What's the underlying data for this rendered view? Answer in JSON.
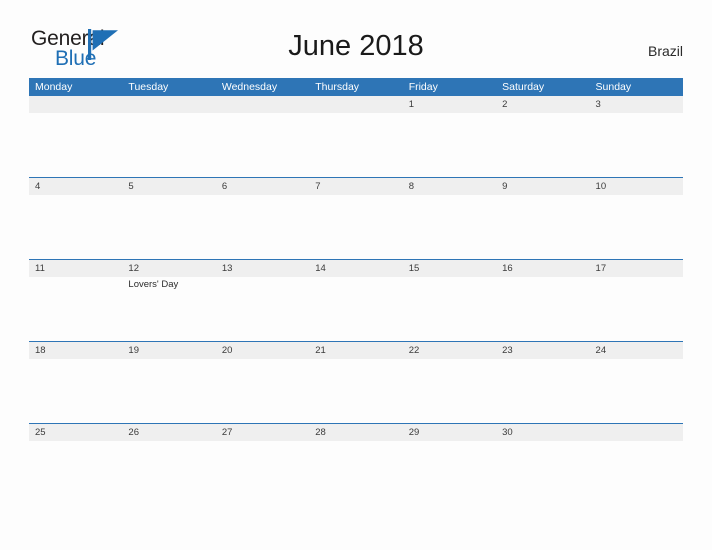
{
  "brand": {
    "name_part1": "General",
    "name_part2": "Blue",
    "mark": "triangle-flag-icon",
    "color_dark": "#221f1f",
    "color_blue": "#1f6fb5"
  },
  "header": {
    "title": "June 2018",
    "country": "Brazil"
  },
  "theme": {
    "header_blue": "#2e75b6",
    "date_band_gray": "#efefef",
    "row_divider": "#2e75b6",
    "page_background": "#fdfdfd"
  },
  "calendar": {
    "month": "June",
    "year": "2018",
    "week_start": "Monday",
    "weekdays": [
      "Monday",
      "Tuesday",
      "Wednesday",
      "Thursday",
      "Friday",
      "Saturday",
      "Sunday"
    ],
    "weeks": [
      {
        "days": [
          {
            "date": "",
            "event": ""
          },
          {
            "date": "",
            "event": ""
          },
          {
            "date": "",
            "event": ""
          },
          {
            "date": "",
            "event": ""
          },
          {
            "date": "1",
            "event": ""
          },
          {
            "date": "2",
            "event": ""
          },
          {
            "date": "3",
            "event": ""
          }
        ]
      },
      {
        "days": [
          {
            "date": "4",
            "event": ""
          },
          {
            "date": "5",
            "event": ""
          },
          {
            "date": "6",
            "event": ""
          },
          {
            "date": "7",
            "event": ""
          },
          {
            "date": "8",
            "event": ""
          },
          {
            "date": "9",
            "event": ""
          },
          {
            "date": "10",
            "event": ""
          }
        ]
      },
      {
        "days": [
          {
            "date": "11",
            "event": ""
          },
          {
            "date": "12",
            "event": "Lovers' Day"
          },
          {
            "date": "13",
            "event": ""
          },
          {
            "date": "14",
            "event": ""
          },
          {
            "date": "15",
            "event": ""
          },
          {
            "date": "16",
            "event": ""
          },
          {
            "date": "17",
            "event": ""
          }
        ]
      },
      {
        "days": [
          {
            "date": "18",
            "event": ""
          },
          {
            "date": "19",
            "event": ""
          },
          {
            "date": "20",
            "event": ""
          },
          {
            "date": "21",
            "event": ""
          },
          {
            "date": "22",
            "event": ""
          },
          {
            "date": "23",
            "event": ""
          },
          {
            "date": "24",
            "event": ""
          }
        ]
      },
      {
        "days": [
          {
            "date": "25",
            "event": ""
          },
          {
            "date": "26",
            "event": ""
          },
          {
            "date": "27",
            "event": ""
          },
          {
            "date": "28",
            "event": ""
          },
          {
            "date": "29",
            "event": ""
          },
          {
            "date": "30",
            "event": ""
          },
          {
            "date": "",
            "event": ""
          }
        ]
      }
    ]
  }
}
